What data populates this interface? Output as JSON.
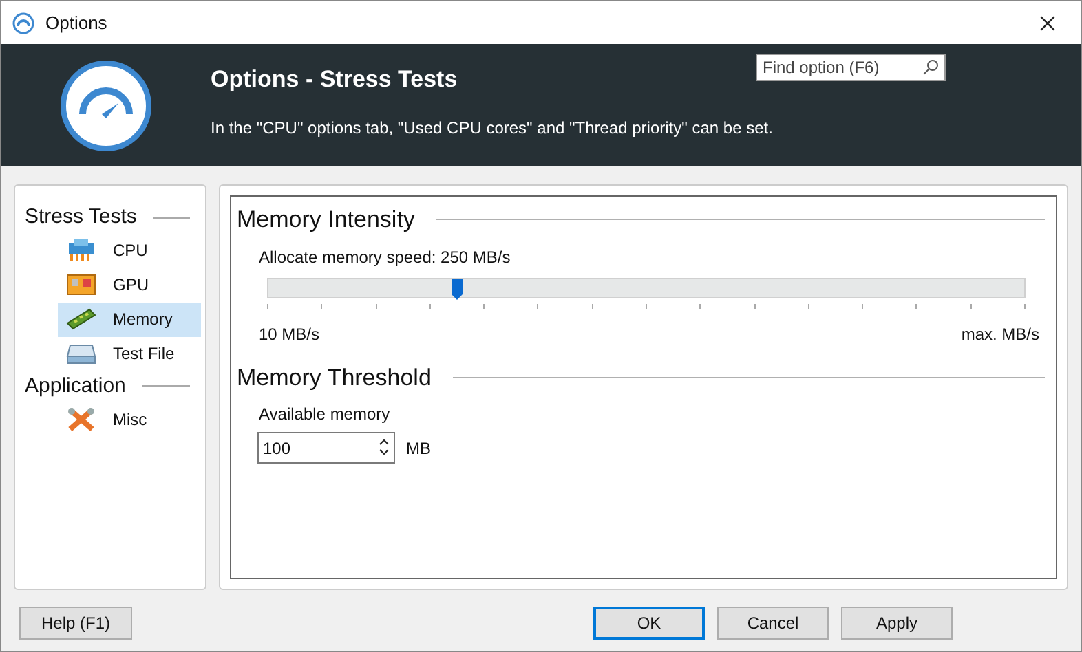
{
  "window": {
    "title": "Options"
  },
  "header": {
    "title": "Options - Stress Tests",
    "description": "In the \"CPU\" options tab, \"Used CPU cores\" and \"Thread priority\" can be set.",
    "search": {
      "placeholder": "Find option (F6)"
    }
  },
  "sidebar": {
    "groups": [
      {
        "label": "Stress Tests",
        "items": [
          {
            "label": "CPU",
            "kind": "cpu",
            "selected": false
          },
          {
            "label": "GPU",
            "kind": "gpu",
            "selected": false
          },
          {
            "label": "Memory",
            "kind": "memory",
            "selected": true
          },
          {
            "label": "Test File",
            "kind": "disk",
            "selected": false
          }
        ]
      },
      {
        "label": "Application",
        "items": [
          {
            "label": "Misc",
            "kind": "tools",
            "selected": false
          }
        ]
      }
    ]
  },
  "intensity": {
    "title": "Memory Intensity",
    "label": "Allocate memory speed: 250 MB/s",
    "level": 0.25,
    "min_label": "10 MB/s",
    "max_label": "max. MB/s"
  },
  "threshold": {
    "title": "Memory Threshold",
    "label": "Available memory",
    "value": "100",
    "unit": "MB"
  },
  "buttons": {
    "help": "Help (F1)",
    "ok": "OK",
    "cancel": "Cancel",
    "apply": "Apply"
  }
}
